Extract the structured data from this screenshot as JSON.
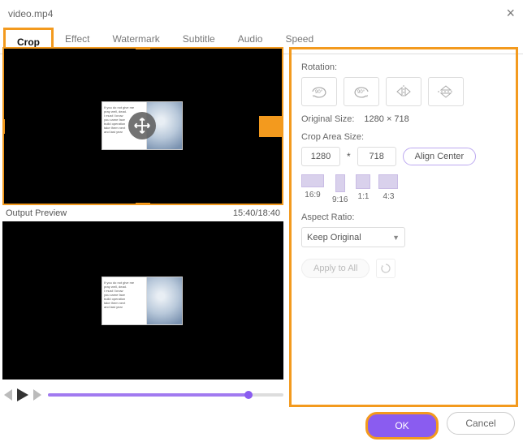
{
  "header": {
    "title": "video.mp4"
  },
  "tabs": [
    "Crop",
    "Effect",
    "Watermark",
    "Subtitle",
    "Audio",
    "Speed"
  ],
  "active_tab": 0,
  "preview": {
    "title_label": "Output Preview",
    "time": "15:40/18:40"
  },
  "rotation": {
    "label": "Rotation:"
  },
  "original_size": {
    "label": "Original Size:",
    "value": "1280 × 718"
  },
  "crop_area": {
    "label": "Crop Area Size:",
    "width": "1280",
    "height": "718",
    "align_label": "Align Center"
  },
  "aspect_ratios": [
    {
      "label": "16:9",
      "cls": "ar-169"
    },
    {
      "label": "9:16",
      "cls": "ar-916"
    },
    {
      "label": "1:1",
      "cls": "ar-11"
    },
    {
      "label": "4:3",
      "cls": "ar-43"
    }
  ],
  "aspect_ratio_label": "Aspect Ratio:",
  "aspect_select": "Keep Original",
  "apply_all": "Apply to All",
  "footer": {
    "ok": "OK",
    "cancel": "Cancel"
  },
  "highlight": "#f39a1e",
  "accent": "#8a5cf0"
}
